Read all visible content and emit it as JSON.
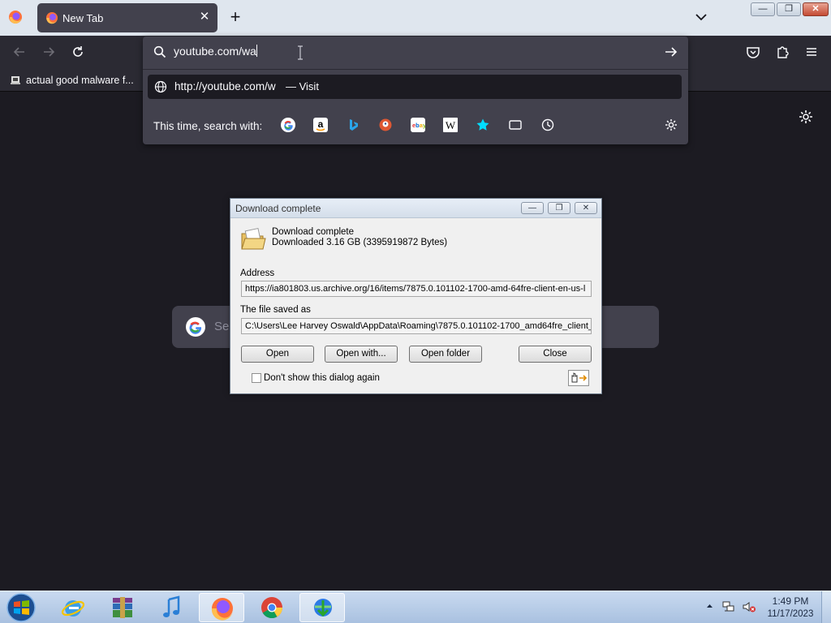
{
  "tab": {
    "title": "New Tab",
    "close": "✕"
  },
  "newtab_button": "+",
  "window_controls": {
    "minimize": "—",
    "restore": "❐",
    "close": "✕"
  },
  "bookmarks": [
    {
      "label": "actual good malware f..."
    }
  ],
  "urlbar": {
    "value": "youtube.com/wa",
    "result_url": "http://youtube.com/w",
    "result_action": "— Visit",
    "search_with_label": "This time, search with:"
  },
  "search_engines": [
    "Google",
    "Amazon",
    "Bing",
    "DuckDuckGo",
    "eBay",
    "Wikipedia",
    "Bookmarks",
    "Tabs",
    "History"
  ],
  "newtab_search": {
    "placeholder": "Se"
  },
  "download_dialog": {
    "title": "Download complete",
    "heading": "Download complete",
    "size": "Downloaded 3.16  GB (3395919872 Bytes)",
    "address_label": "Address",
    "address": "https://ia801803.us.archive.org/16/items/7875.0.101102-1700-amd-64fre-client-en-us-l",
    "saved_label": "The file saved as",
    "saved_path": "C:\\Users\\Lee Harvey Oswald\\AppData\\Roaming\\7875.0.101102-1700_amd64fre_client_",
    "buttons": {
      "open": "Open",
      "open_with": "Open with...",
      "open_folder": "Open folder",
      "close": "Close"
    },
    "checkbox_label": "Don't show this dialog again",
    "controls": {
      "minimize": "—",
      "restore": "❐",
      "close": "✕"
    }
  },
  "taskbar": {
    "apps": [
      "Internet Explorer",
      "WinRAR",
      "iTunes",
      "Firefox",
      "Chrome",
      "Internet Download Manager"
    ],
    "active_app": "Firefox",
    "time": "1:49 PM",
    "date": "11/17/2023"
  },
  "colors": {
    "browser_bg": "#1c1b22",
    "toolbar": "#2b2a33",
    "urlbar": "#42414d",
    "tabstrip": "#dfe6ee",
    "taskbar": "#b9cfe8"
  }
}
